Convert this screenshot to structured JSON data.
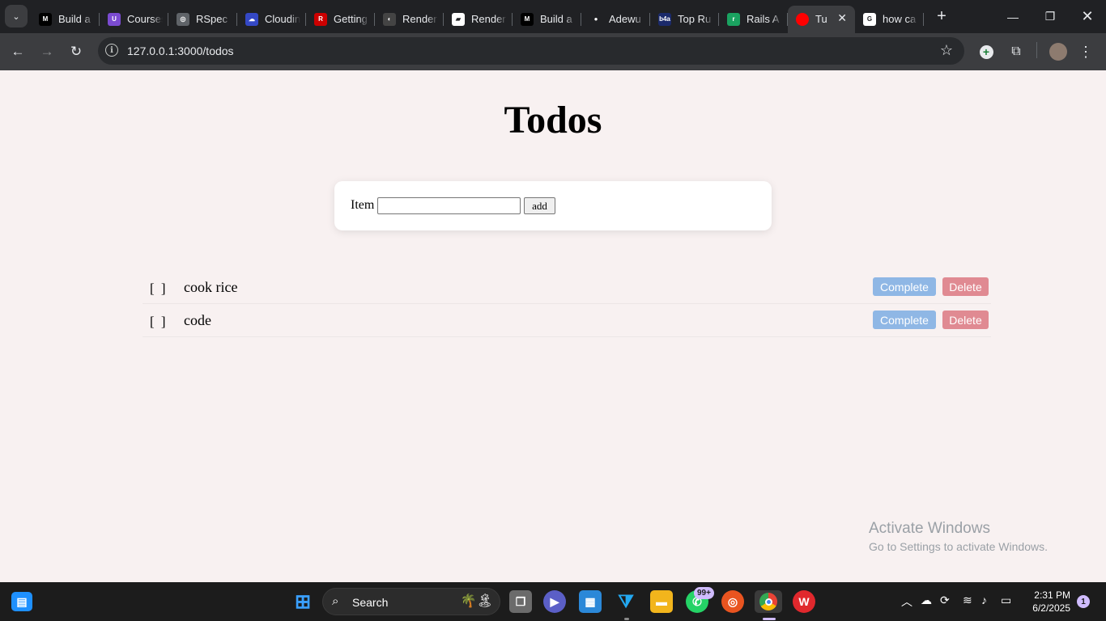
{
  "browser": {
    "tabs": [
      {
        "label": "Build a",
        "favicon": "medium-icon",
        "color": "#000000",
        "glyph": "M"
      },
      {
        "label": "Courses",
        "favicon": "course-shield-icon",
        "color": "#7b4bd1",
        "glyph": "U"
      },
      {
        "label": "RSpec",
        "favicon": "rspec-icon",
        "color": "#5f6368",
        "glyph": "◎"
      },
      {
        "label": "Cloudinary",
        "favicon": "cloudinary-icon",
        "color": "#3448c5",
        "glyph": "☁"
      },
      {
        "label": "Getting",
        "favicon": "rails-icon",
        "color": "#cc0000",
        "glyph": "R"
      },
      {
        "label": "Render",
        "favicon": "render-icon",
        "color": "#444444",
        "glyph": "◐"
      },
      {
        "label": "Render",
        "favicon": "render-logo-icon",
        "color": "#ffffff",
        "glyph": "▰"
      },
      {
        "label": "Build a",
        "favicon": "medium-icon",
        "color": "#000000",
        "glyph": "M"
      },
      {
        "label": "Adewu",
        "favicon": "github-icon",
        "color": "#202124",
        "glyph": "●"
      },
      {
        "label": "Top Ru",
        "favicon": "b4a-icon",
        "color": "#1b2a6b",
        "glyph": "b4a"
      },
      {
        "label": "Rails A",
        "favicon": "rails-api-icon",
        "color": "#1aa260",
        "glyph": "r"
      },
      {
        "label": "Tu",
        "favicon": "record-icon",
        "color": "#ff0000",
        "glyph": "",
        "active": true
      },
      {
        "label": "how ca",
        "favicon": "google-icon",
        "color": "#ffffff",
        "glyph": "G"
      }
    ],
    "url": "127.0.0.1:3000/todos"
  },
  "page": {
    "title": "Todos",
    "form": {
      "item_label": "Item",
      "item_value": "",
      "add_label": "add"
    },
    "todos": [
      {
        "checkbox": "[ ]",
        "text": "cook rice",
        "complete_label": "Complete",
        "delete_label": "Delete"
      },
      {
        "checkbox": "[ ]",
        "text": "code",
        "complete_label": "Complete",
        "delete_label": "Delete"
      }
    ],
    "watermark": {
      "line1": "Activate Windows",
      "line2": "Go to Settings to activate Windows."
    }
  },
  "taskbar": {
    "search_label": "Search",
    "whatsapp_badge": "99+",
    "time": "2:31 PM",
    "date": "6/2/2025",
    "notification_count": "1"
  },
  "colors": {
    "page_background": "#f8f1f1",
    "complete_button": "#8fb7e5",
    "delete_button": "#e08a92",
    "chrome_dark": "#202124",
    "toolbar": "#3c3d40"
  }
}
